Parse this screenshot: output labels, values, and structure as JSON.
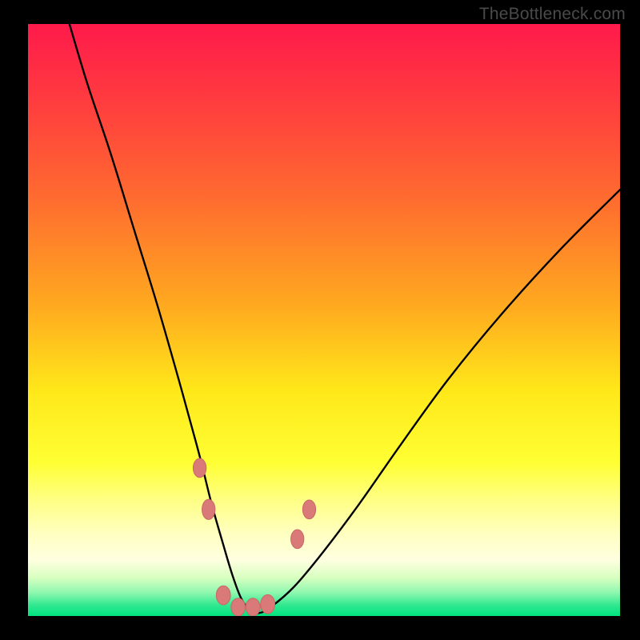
{
  "watermark": {
    "text": "TheBottleneck.com"
  },
  "colors": {
    "black": "#000000",
    "curve": "#000000",
    "marker_fill": "#d97a78",
    "marker_stroke": "#c96865",
    "gradient_stops": [
      {
        "offset": 0.0,
        "color": "#ff1a4b"
      },
      {
        "offset": 0.12,
        "color": "#ff3940"
      },
      {
        "offset": 0.3,
        "color": "#ff6d2f"
      },
      {
        "offset": 0.48,
        "color": "#ffab1f"
      },
      {
        "offset": 0.62,
        "color": "#ffe81a"
      },
      {
        "offset": 0.74,
        "color": "#ffff33"
      },
      {
        "offset": 0.8,
        "color": "#ffff80"
      },
      {
        "offset": 0.86,
        "color": "#ffffc0"
      },
      {
        "offset": 0.905,
        "color": "#ffffe0"
      },
      {
        "offset": 0.935,
        "color": "#d8ffc0"
      },
      {
        "offset": 0.96,
        "color": "#90f8b0"
      },
      {
        "offset": 0.982,
        "color": "#30e890"
      },
      {
        "offset": 1.0,
        "color": "#00e27e"
      }
    ]
  },
  "chart_data": {
    "type": "line",
    "title": "",
    "xlabel": "",
    "ylabel": "",
    "xlim": [
      0,
      100
    ],
    "ylim": [
      0,
      100
    ],
    "series": [
      {
        "name": "bottleneck-curve",
        "x": [
          7,
          10,
          14,
          18,
          22,
          26,
          29,
          31,
          33,
          34.5,
          36,
          37.5,
          39,
          41,
          45,
          50,
          56,
          63,
          71,
          80,
          90,
          100
        ],
        "y": [
          100,
          90,
          78,
          65,
          52,
          38,
          27,
          19,
          12,
          7,
          3,
          1,
          0.5,
          1.5,
          5,
          11,
          19,
          29,
          40,
          51,
          62,
          72
        ]
      }
    ],
    "markers": [
      {
        "name": "left-upper",
        "x": 29.0,
        "y": 25,
        "rx": 2.2,
        "ry": 3.2
      },
      {
        "name": "left-lower",
        "x": 30.5,
        "y": 18,
        "rx": 2.2,
        "ry": 3.4
      },
      {
        "name": "trough-1",
        "x": 33.0,
        "y": 3.5,
        "rx": 2.4,
        "ry": 3.2
      },
      {
        "name": "trough-2",
        "x": 35.5,
        "y": 1.5,
        "rx": 2.4,
        "ry": 3.0
      },
      {
        "name": "trough-3",
        "x": 38.0,
        "y": 1.5,
        "rx": 2.4,
        "ry": 3.0
      },
      {
        "name": "trough-4",
        "x": 40.5,
        "y": 2.0,
        "rx": 2.4,
        "ry": 3.2
      },
      {
        "name": "right-lower",
        "x": 45.5,
        "y": 13,
        "rx": 2.2,
        "ry": 3.2
      },
      {
        "name": "right-upper",
        "x": 47.5,
        "y": 18,
        "rx": 2.2,
        "ry": 3.2
      }
    ]
  }
}
